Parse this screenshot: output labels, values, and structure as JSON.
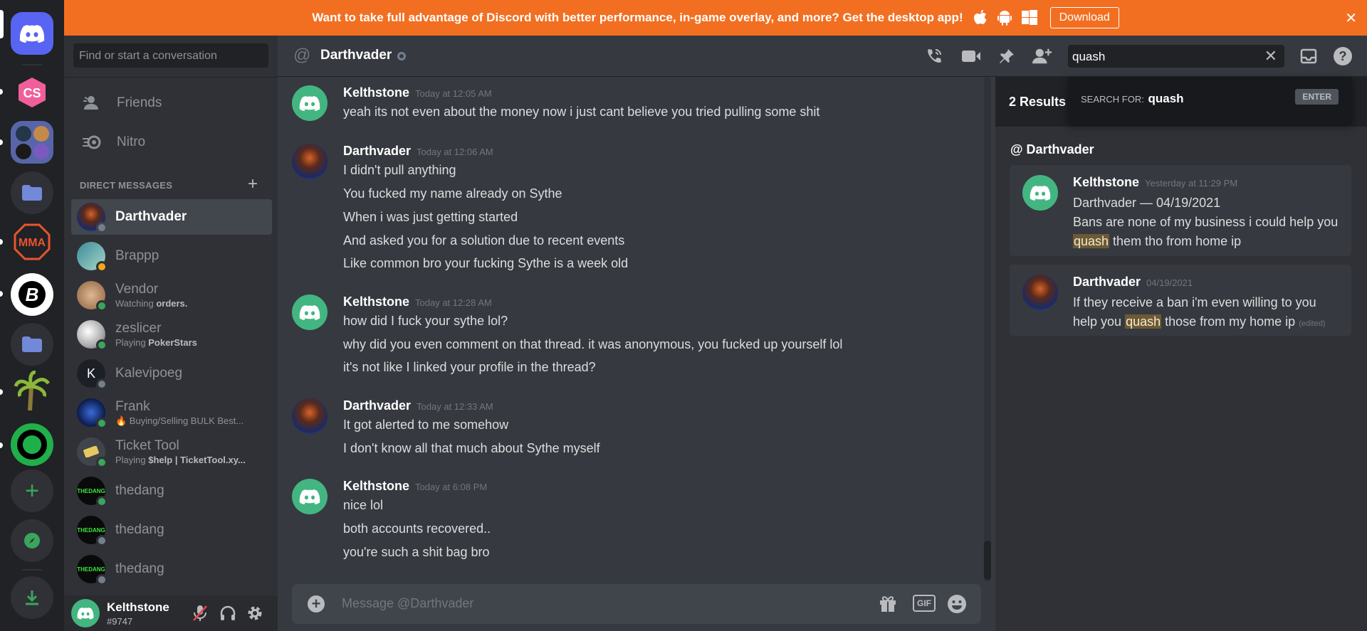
{
  "banner": {
    "text": "Want to take full advantage of Discord with better performance, in-game overlay, and more? Get the desktop app!",
    "download_label": "Download",
    "close_glyph": "✕",
    "color": "#f26f21"
  },
  "dm_sidebar": {
    "search_placeholder": "Find or start a conversation",
    "nav": [
      {
        "label": "Friends",
        "icon": "friends-icon"
      },
      {
        "label": "Nitro",
        "icon": "nitro-icon"
      }
    ],
    "section_title": "DIRECT MESSAGES",
    "add_glyph": "+",
    "items": [
      {
        "name": "Darthvader",
        "sub": "",
        "sub_bold": ""
      },
      {
        "name": "Brappp",
        "sub": "",
        "sub_bold": ""
      },
      {
        "name": "Vendor",
        "sub": "Watching ",
        "sub_bold": "orders."
      },
      {
        "name": "zeslicer",
        "sub": "Playing ",
        "sub_bold": "PokerStars"
      },
      {
        "name": "Kalevipoeg",
        "sub": "",
        "sub_bold": ""
      },
      {
        "name": "Frank",
        "sub": "🔥 Buying/Selling BULK Best...",
        "sub_bold": ""
      },
      {
        "name": "Ticket Tool",
        "sub": "Playing ",
        "sub_bold": "$help | TicketTool.xy..."
      },
      {
        "name": "thedang",
        "sub": "",
        "sub_bold": ""
      },
      {
        "name": "thedang",
        "sub": "",
        "sub_bold": ""
      },
      {
        "name": "thedang",
        "sub": "",
        "sub_bold": ""
      }
    ]
  },
  "user": {
    "name": "Kelthstone",
    "tag": "#9747"
  },
  "header": {
    "at_glyph": "@",
    "title": "Darthvader",
    "search_value": "quash",
    "search_clear_glyph": "✕",
    "help_glyph": "?"
  },
  "messages": [
    {
      "author": "Kelthstone",
      "time": "Today at 12:05 AM",
      "lines": [
        "yeah its not even about the money now i just cant believe you tried pulling some shit"
      ]
    },
    {
      "author": "Darthvader",
      "time": "Today at 12:06 AM",
      "lines": [
        "I didn't pull anything",
        "You fucked my name already on Sythe",
        "When i was just getting started",
        "And asked you for a solution due to recent events",
        "Like common bro your fucking Sythe is a week old"
      ]
    },
    {
      "author": "Kelthstone",
      "time": "Today at 12:28 AM",
      "lines": [
        "how did I fuck your sythe lol?",
        "why did you even comment on that thread. it was anonymous, you fucked up yourself lol",
        "it's not like I linked your profile in the thread?"
      ]
    },
    {
      "author": "Darthvader",
      "time": "Today at 12:33 AM",
      "lines": [
        "It got alerted to me somehow",
        "I don't know all that much about Sythe myself"
      ]
    },
    {
      "author": "Kelthstone",
      "time": "Today at 6:08 PM",
      "lines": [
        "nice lol",
        "both accounts recovered..",
        "you're such a shit bag bro"
      ]
    }
  ],
  "composer": {
    "placeholder": "Message @Darthvader",
    "plus_glyph": "+",
    "gif_label": "GIF"
  },
  "search_dropdown": {
    "label": "SEARCH FOR:",
    "query": "quash",
    "enter_label": "ENTER"
  },
  "results": {
    "count": "2 Results",
    "channel": "@ Darthvader",
    "items": [
      {
        "author": "Kelthstone",
        "time": "Yesterday at 11:29 PM",
        "line1": "Darthvader — 04/19/2021",
        "pre": "Bans are none of my business i could help you ",
        "hl": "quash",
        "post": " them tho from home ip",
        "edited": ""
      },
      {
        "author": "Darthvader",
        "time": "04/19/2021",
        "line1": "",
        "pre": "If they receive a ban i'm even willing to you help you ",
        "hl": "quash",
        "post": " those from my home ip",
        "edited": "(edited)"
      }
    ]
  }
}
